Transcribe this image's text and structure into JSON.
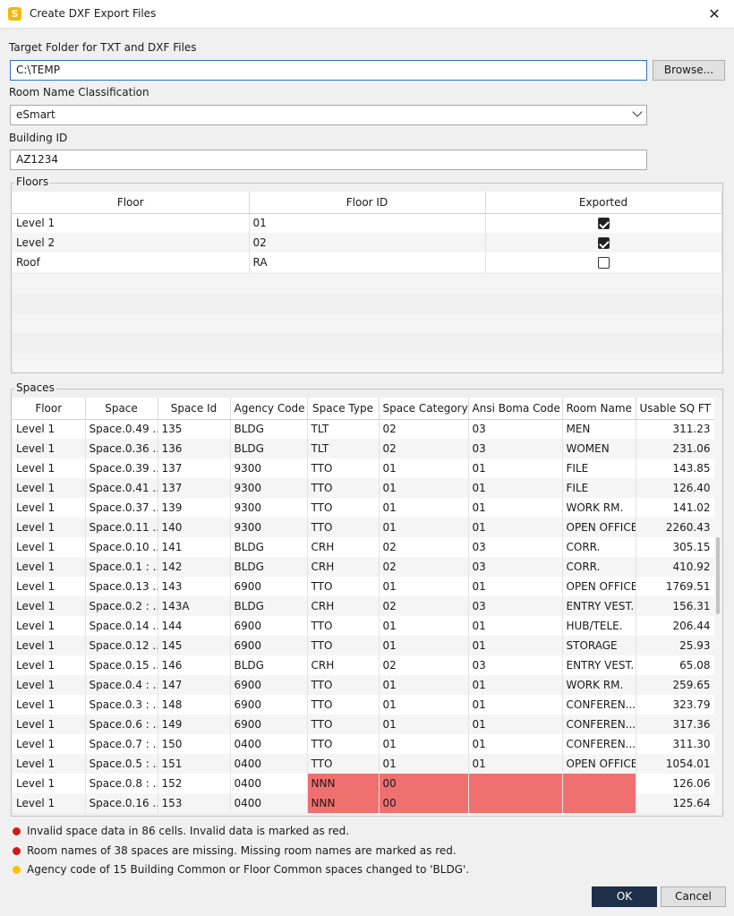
{
  "window": {
    "title": "Create DXF Export Files",
    "app_icon_letter": "S",
    "close_glyph": "✕"
  },
  "target_folder": {
    "label": "Target Folder for TXT and DXF Files",
    "value": "C:\\TEMP",
    "browse_label": "Browse..."
  },
  "classification": {
    "label": "Room Name Classification",
    "value": "eSmart"
  },
  "building": {
    "label": "Building ID",
    "value": "AZ1234"
  },
  "floors": {
    "title": "Floors",
    "headers": [
      "Floor",
      "Floor ID",
      "Exported"
    ],
    "rows": [
      {
        "floor": "Level 1",
        "id": "01",
        "exported": true
      },
      {
        "floor": "Level 2",
        "id": "02",
        "exported": true
      },
      {
        "floor": "Roof",
        "id": "RA",
        "exported": false
      }
    ]
  },
  "spaces": {
    "title": "Spaces",
    "headers": [
      "Floor",
      "Space",
      "Space Id",
      "Agency Code",
      "Space Type",
      "Space Category",
      "Ansi Boma Code",
      "Room Name",
      "Usable SQ FT"
    ],
    "rows": [
      [
        "Level 1",
        "Space.0.49 ...",
        "135",
        "BLDG",
        "TLT",
        "02",
        "03",
        "MEN",
        "311.23"
      ],
      [
        "Level 1",
        "Space.0.36 ...",
        "136",
        "BLDG",
        "TLT",
        "02",
        "03",
        "WOMEN",
        "231.06"
      ],
      [
        "Level 1",
        "Space.0.39 ...",
        "137",
        "9300",
        "TTO",
        "01",
        "01",
        "FILE",
        "143.85"
      ],
      [
        "Level 1",
        "Space.0.41 ...",
        "137",
        "9300",
        "TTO",
        "01",
        "01",
        "FILE",
        "126.40"
      ],
      [
        "Level 1",
        "Space.0.37 ...",
        "139",
        "9300",
        "TTO",
        "01",
        "01",
        "WORK RM.",
        "141.02"
      ],
      [
        "Level 1",
        "Space.0.11 ...",
        "140",
        "9300",
        "TTO",
        "01",
        "01",
        "OPEN OFFICE",
        "2260.43"
      ],
      [
        "Level 1",
        "Space.0.10 ...",
        "141",
        "BLDG",
        "CRH",
        "02",
        "03",
        "CORR.",
        "305.15"
      ],
      [
        "Level 1",
        "Space.0.1 : ...",
        "142",
        "BLDG",
        "CRH",
        "02",
        "03",
        "CORR.",
        "410.92"
      ],
      [
        "Level 1",
        "Space.0.13 ...",
        "143",
        "6900",
        "TTO",
        "01",
        "01",
        "OPEN OFFICE",
        "1769.51"
      ],
      [
        "Level 1",
        "Space.0.2 : ...",
        "143A",
        "BLDG",
        "CRH",
        "02",
        "03",
        "ENTRY VEST.",
        "156.31"
      ],
      [
        "Level 1",
        "Space.0.14 ...",
        "144",
        "6900",
        "TTO",
        "01",
        "01",
        "HUB/TELE.",
        "206.44"
      ],
      [
        "Level 1",
        "Space.0.12 ...",
        "145",
        "6900",
        "TTO",
        "01",
        "01",
        "STORAGE",
        "25.93"
      ],
      [
        "Level 1",
        "Space.0.15 ...",
        "146",
        "BLDG",
        "CRH",
        "02",
        "03",
        "ENTRY VEST.",
        "65.08"
      ],
      [
        "Level 1",
        "Space.0.4 : ...",
        "147",
        "6900",
        "TTO",
        "01",
        "01",
        "WORK RM.",
        "259.65"
      ],
      [
        "Level 1",
        "Space.0.3 : ...",
        "148",
        "6900",
        "TTO",
        "01",
        "01",
        "CONFEREN...",
        "323.79"
      ],
      [
        "Level 1",
        "Space.0.6 : ...",
        "149",
        "6900",
        "TTO",
        "01",
        "01",
        "CONFEREN...",
        "317.36"
      ],
      [
        "Level 1",
        "Space.0.7 : ...",
        "150",
        "0400",
        "TTO",
        "01",
        "01",
        "CONFEREN...",
        "311.30"
      ],
      [
        "Level 1",
        "Space.0.5 : ...",
        "151",
        "0400",
        "TTO",
        "01",
        "01",
        "OPEN OFFICE",
        "1054.01"
      ],
      [
        "Level 1",
        "Space.0.8 : ...",
        "152",
        "0400",
        "NNN",
        "00",
        "",
        "",
        "126.06"
      ],
      [
        "Level 1",
        "Space.0.16 ...",
        "153",
        "0400",
        "NNN",
        "00",
        "",
        "",
        "125.64"
      ]
    ]
  },
  "messages": [
    {
      "text": "Invalid space data in 86 cells. Invalid data is marked as red.",
      "color": "#cc1b1b"
    },
    {
      "text": "Room names of 38 spaces are missing. Missing room names are marked as red.",
      "color": "#cc1b1b"
    },
    {
      "text": "Agency code of 15 Building Common or Floor Common spaces changed to 'BLDG'.",
      "color": "#f5c400"
    }
  ],
  "buttons": {
    "ok": "OK",
    "cancel": "Cancel"
  },
  "colors": {
    "invalid_cell": "#f07070",
    "primary_button": "#1e2f4a"
  }
}
